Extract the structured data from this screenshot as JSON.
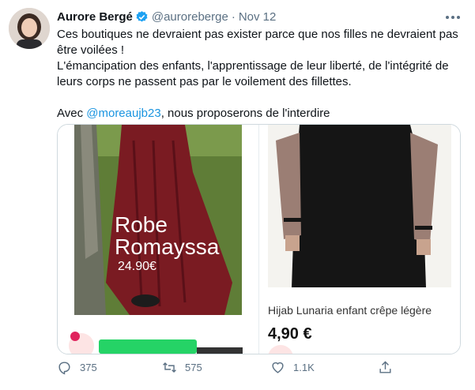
{
  "author": {
    "name": "Aurore Bergé",
    "handle": "@auroreberge",
    "date": "Nov 12"
  },
  "icons": {
    "verified": "verified-badge-icon",
    "more": "more-dots-icon",
    "reply": "reply-icon",
    "retweet": "retweet-icon",
    "like": "heart-icon",
    "share": "share-icon"
  },
  "tweet": {
    "line1": "Ces boutiques ne devraient pas exister parce que nos filles ne devraient pas être voilées !",
    "line2": "L'émancipation des enfants, l'apprentissage de leur liberté, de l'intégrité de leurs corps ne passent pas par le voilement des fillettes.",
    "line3_pre": "Avec ",
    "mention": "@moreaujb23",
    "line3_post": ", nous proposerons de l'interdire"
  },
  "media": {
    "left": {
      "title_line1": "Robe",
      "title_line2": "Romayssa",
      "price": "24.90€"
    },
    "right": {
      "product_name": "Hijab Lunaria enfant crêpe légère",
      "price": "4,90 €"
    }
  },
  "actions": {
    "reply_count": "375",
    "retweet_count": "575",
    "like_count": "1.1K"
  },
  "colors": {
    "accent": "#1b95e0",
    "muted": "#5b7083",
    "robe": "#7a1b22",
    "verified": "#1da1f2"
  }
}
